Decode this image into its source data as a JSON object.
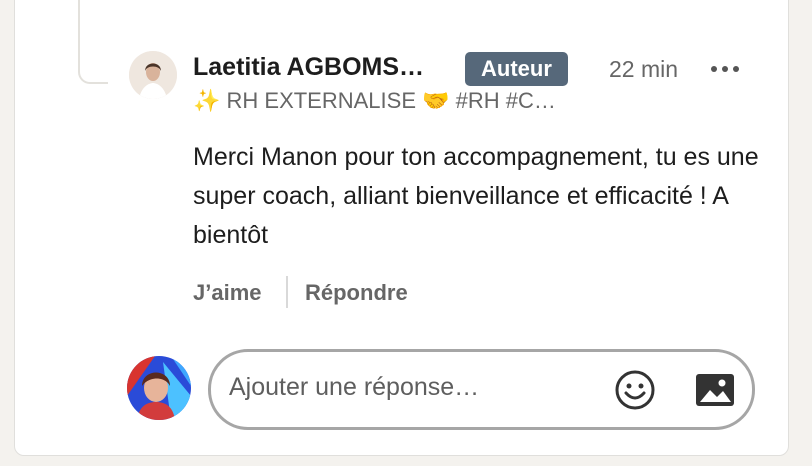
{
  "comment": {
    "author_name": "Laetitia AGBOMS…",
    "badge": "Auteur",
    "time": "22 min",
    "headline": "✨ RH EXTERNALISE 🤝 #RH #C…",
    "text": "Merci Manon pour ton accompagnement, tu es une super coach, alliant bienveillance et efficacité ! A bientôt",
    "actions": {
      "like": "J’aime",
      "reply": "Répondre"
    },
    "icons": {
      "more": "more-options-icon",
      "avatar": "author-avatar"
    }
  },
  "reply": {
    "placeholder": "Ajouter une réponse…",
    "icons": {
      "emoji": "emoji-icon",
      "image": "image-icon"
    }
  },
  "colors": {
    "badge_bg": "#56687a",
    "muted_text": "#666666",
    "border": "#a6a6a6"
  }
}
